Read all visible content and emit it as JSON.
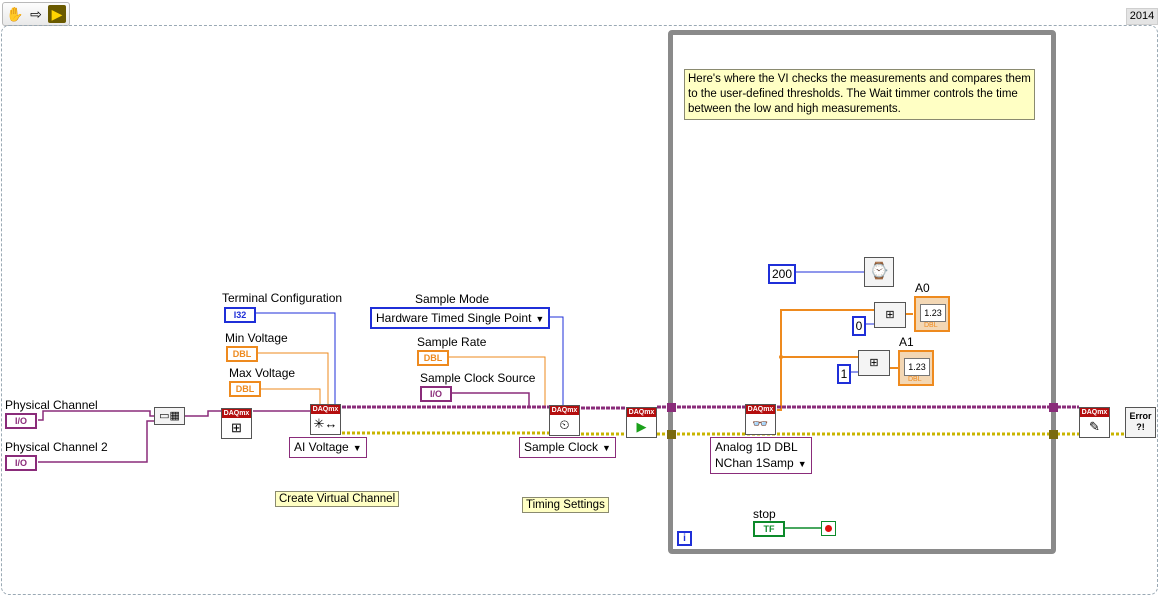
{
  "toolbar": {
    "run_continuously_icon": "hand-icon",
    "step_icon": "arrow-right-icon",
    "highlight_icon": "bulb-icon"
  },
  "version_badge": "2014",
  "labels": {
    "physical_channel": "Physical Channel",
    "physical_channel_2": "Physical Channel 2",
    "terminal_configuration": "Terminal Configuration",
    "min_voltage": "Min Voltage",
    "max_voltage": "Max Voltage",
    "sample_mode": "Sample Mode",
    "sample_rate": "Sample Rate",
    "sample_clock_source": "Sample Clock Source",
    "a0": "A0",
    "a1": "A1",
    "stop": "stop"
  },
  "constants": {
    "io_type": "I/O",
    "i32_type": "I32",
    "dbl_type": "DBL",
    "tf_type": "TF",
    "wait_ms": "200",
    "index_0": "0",
    "index_1": "1"
  },
  "enums": {
    "sample_mode_value": "Hardware Timed Single Point",
    "ai_voltage": "AI Voltage",
    "sample_clock": "Sample Clock",
    "read_mode": "Analog 1D DBL\nNChan 1Samp"
  },
  "comments": {
    "create_virtual_channel": "Create Virtual Channel",
    "timing_settings": "Timing Settings",
    "loop_note": "Here's where the VI checks the measurements and compares them\nto the user-defined thresholds. The Wait timmer controls the time\nbetween the low and high measurements."
  },
  "nodes": {
    "daqmx_header": "DAQmx",
    "indicator_value": "1.23",
    "indicator_type": "DBL",
    "error_text": "Error\n?!",
    "iteration": "i"
  },
  "colors": {
    "task_wire": "#8a2c7a",
    "error_wire": "#c8b400",
    "i32_wire": "#1f2fd8",
    "dbl_wire": "#ee8a1e",
    "daqmx_header": "#b40e0e",
    "loop_border": "#8a8a8a",
    "comment_bg": "#ffffc4"
  }
}
